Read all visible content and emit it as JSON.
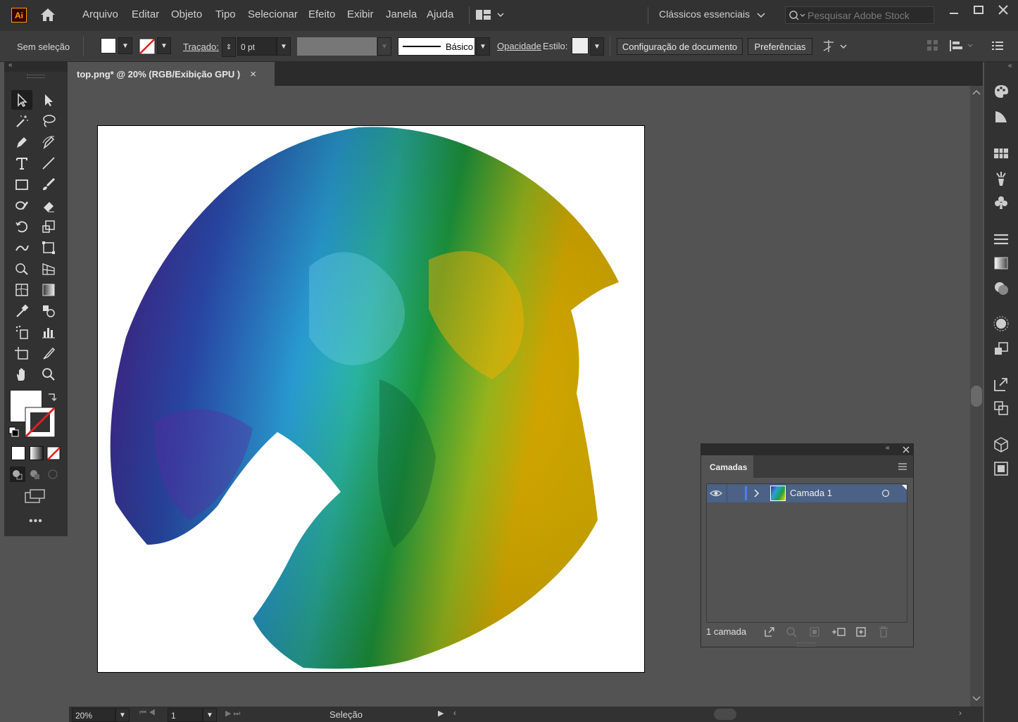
{
  "app": {
    "logo_text": "Ai",
    "workspace": "Clássicos essenciais",
    "search_placeholder": "Pesquisar Adobe Stock"
  },
  "menu": [
    "Arquivo",
    "Editar",
    "Objeto",
    "Tipo",
    "Selecionar",
    "Efeito",
    "Exibir",
    "Janela",
    "Ajuda"
  ],
  "control": {
    "selection": "Sem seleção",
    "stroke_label": "Traçado:",
    "stroke_value": "0 pt",
    "brush_label": "Básico",
    "opacity_label": "Opacidade",
    "style_label": "Estilo:",
    "doc_setup": "Configuração de documento",
    "prefs": "Preferências"
  },
  "document": {
    "tab_title": "top.png* @ 20% (RGB/Exibição GPU )",
    "close": "×"
  },
  "layers_panel": {
    "title": "Camadas",
    "layer_name": "Camada 1",
    "count": "1 camada"
  },
  "status": {
    "zoom": "20%",
    "page": "1",
    "tool": "Seleção"
  },
  "colors": {
    "accent_ai": "#ff9a00",
    "layer_highlight": "#4b6185",
    "layer_color_bar": "#4f7cff"
  },
  "icons": [
    "home-icon",
    "workspace-layout-icon",
    "selection-tool-icon",
    "direct-selection-icon",
    "magic-wand-icon",
    "lasso-icon",
    "pen-icon",
    "curvature-icon",
    "type-icon",
    "line-icon",
    "rectangle-icon",
    "paintbrush-icon",
    "shaper-icon",
    "eraser-icon",
    "rotate-icon",
    "scale-icon",
    "warp-icon",
    "free-transform-icon",
    "shape-builder-icon",
    "perspective-icon",
    "mesh-icon",
    "gradient-icon",
    "eyedropper-icon",
    "blend-icon",
    "symbol-sprayer-icon",
    "graph-icon",
    "artboard-icon",
    "slice-icon",
    "hand-icon",
    "zoom-icon"
  ]
}
